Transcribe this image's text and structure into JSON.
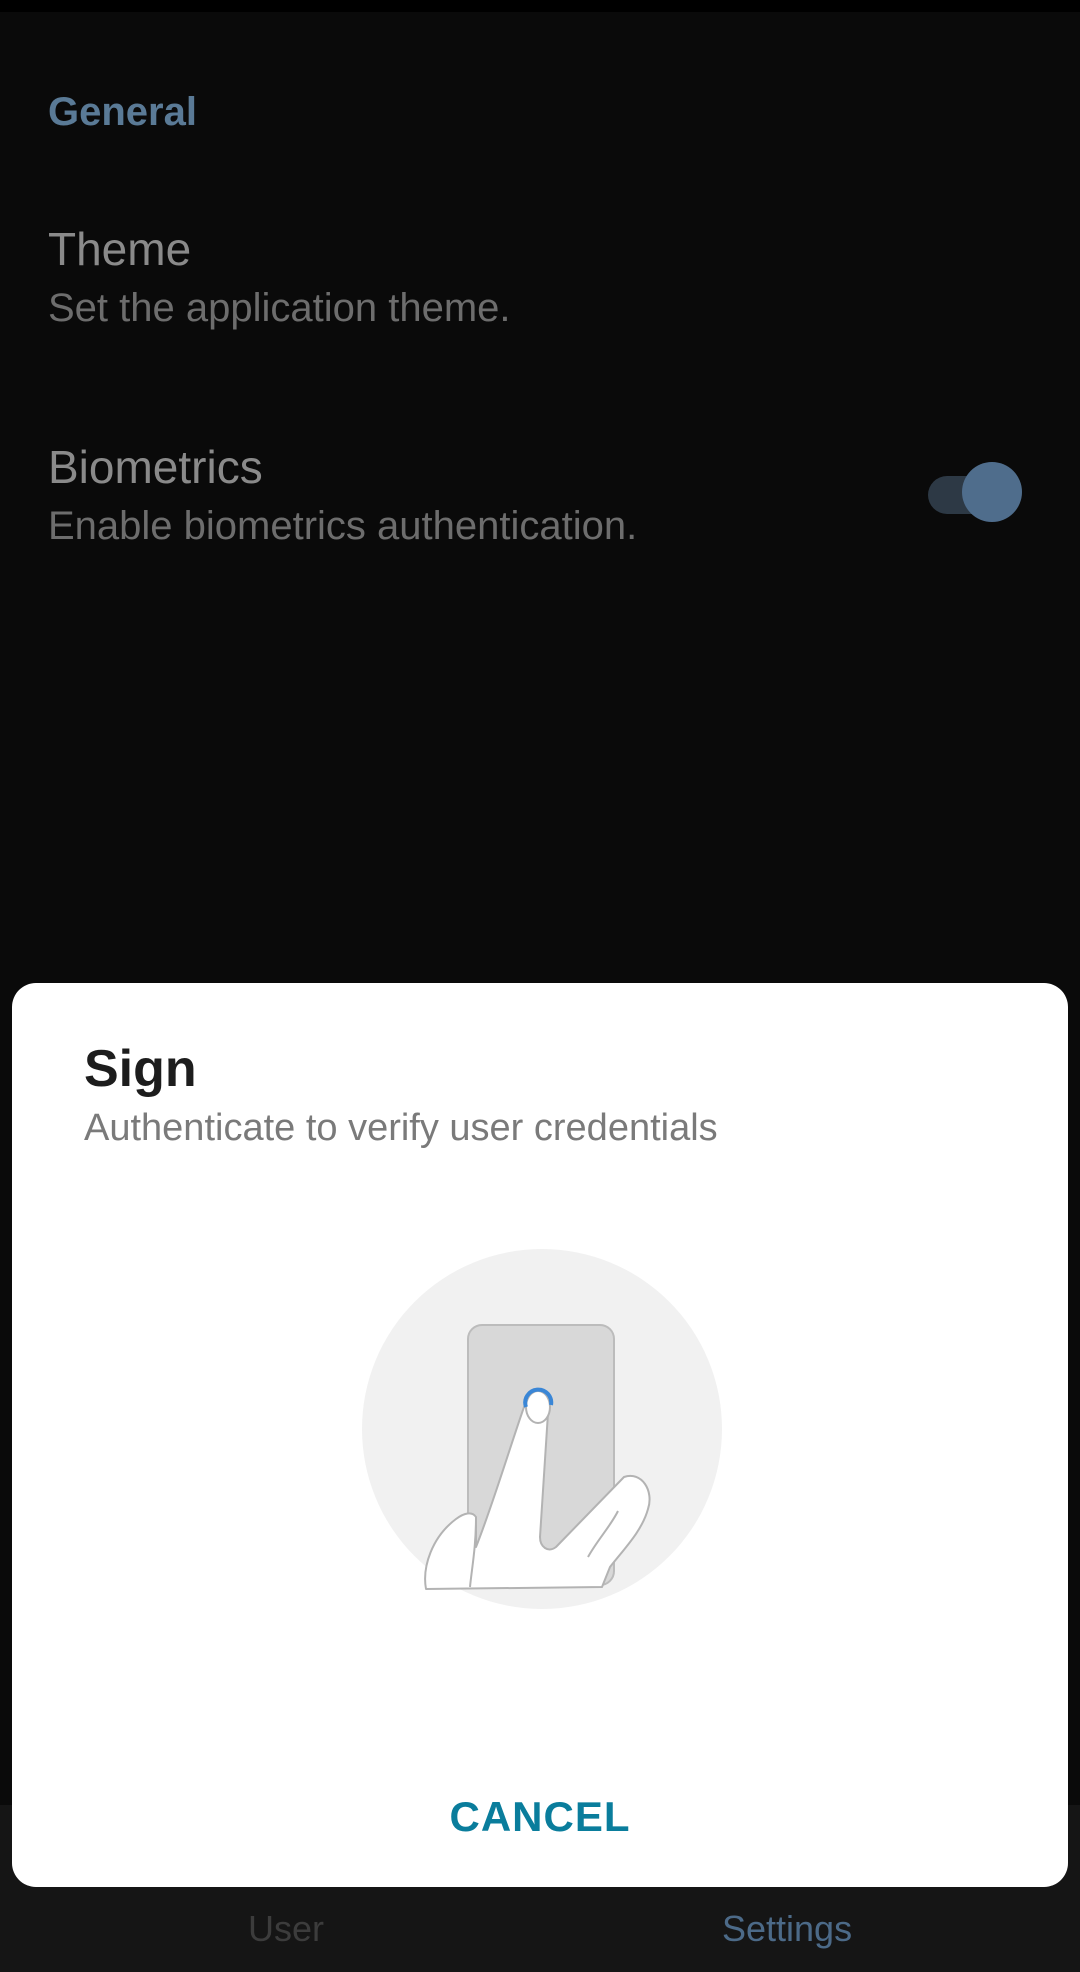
{
  "settings": {
    "section_header": "General",
    "theme": {
      "title": "Theme",
      "subtitle": "Set the application theme."
    },
    "biometrics": {
      "title": "Biometrics",
      "subtitle": "Enable biometrics authentication.",
      "enabled": true
    }
  },
  "bottom_nav": {
    "items": [
      {
        "label": "User",
        "icon": "user-icon",
        "active": false
      },
      {
        "label": "Settings",
        "icon": "settings-icon",
        "active": true
      }
    ]
  },
  "dialog": {
    "title": "Sign",
    "subtitle": "Authenticate to verify user credentials",
    "illustration": "fingerprint-sensor-icon",
    "cancel_label": "CANCEL"
  },
  "colors": {
    "accent": "#5a7a96",
    "dialog_button": "#0a7d9c",
    "background": "#0a0a0a",
    "dialog_background": "#ffffff"
  }
}
